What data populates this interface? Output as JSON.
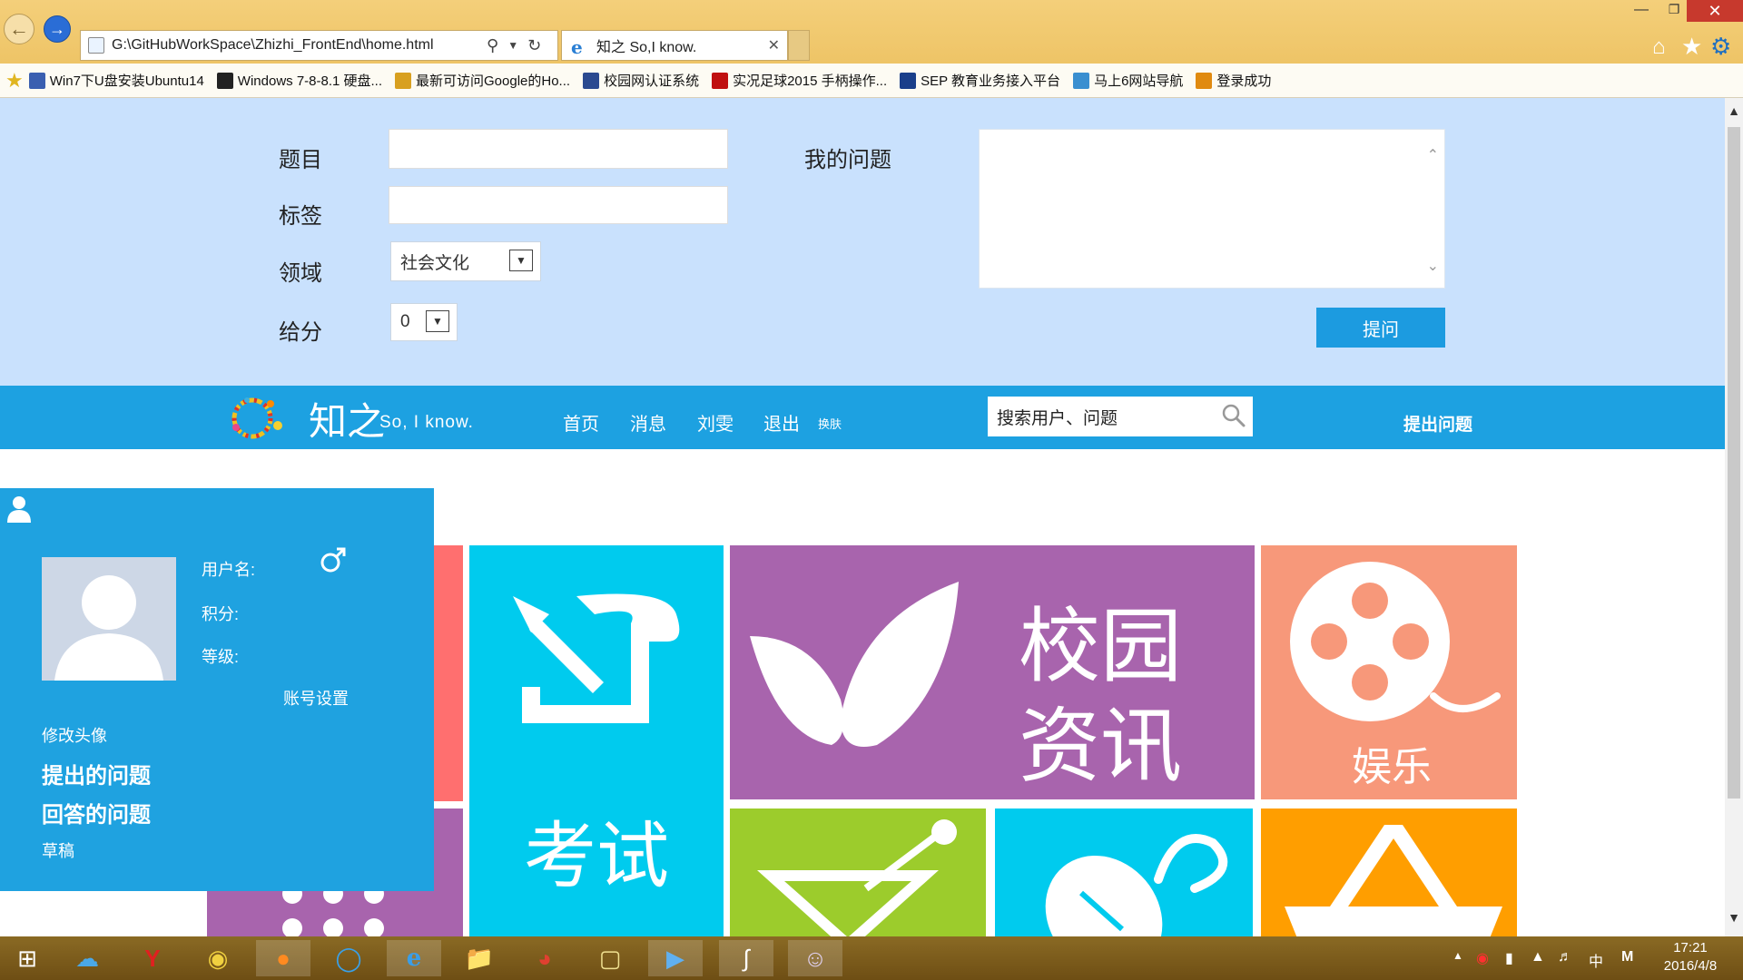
{
  "browser": {
    "address": "G:\\GitHubWorkSpace\\Zhizhi_FrontEnd\\home.html",
    "tab_title": "知之 So,I know.",
    "favorites": [
      {
        "label": "Win7下U盘安装Ubuntu14",
        "color": "#3a5fb0"
      },
      {
        "label": "Windows 7-8-8.1 硬盘...",
        "color": "#222222"
      },
      {
        "label": "最新可访问Google的Ho...",
        "color": "#d8a020"
      },
      {
        "label": "校园网认证系统",
        "color": "#2b4a90"
      },
      {
        "label": "实况足球2015 手柄操作...",
        "color": "#c01010"
      },
      {
        "label": "SEP 教育业务接入平台",
        "color": "#1a3f8a"
      },
      {
        "label": "马上6网站导航",
        "color": "#3a8fd0"
      },
      {
        "label": "登录成功",
        "color": "#e08a10"
      }
    ]
  },
  "ask_form": {
    "title_label": "题目",
    "tags_label": "标签",
    "field_label": "领域",
    "field_value": "社会文化",
    "points_label": "给分",
    "points_value": "0",
    "question_label": "我的问题",
    "submit_label": "提问"
  },
  "nav": {
    "logo_text": "知之",
    "slogan": "So, I know.",
    "links": [
      "首页",
      "消息",
      "刘雯",
      "退出"
    ],
    "skin": "换肤",
    "search_placeholder": "搜索用户、问题",
    "ask_link": "提出问题"
  },
  "tiles": {
    "exam": "考试",
    "campus_line1": "校园",
    "campus_line2": "资讯",
    "entertainment": "娱乐"
  },
  "profile": {
    "username_label": "用户名:",
    "points_label": "积分:",
    "level_label": "等级:",
    "account_settings": "账号设置",
    "change_avatar": "修改头像",
    "asked_questions": "提出的问题",
    "answered_questions": "回答的问题",
    "drafts": "草稿"
  },
  "taskbar": {
    "time": "17:21",
    "date": "2016/4/8",
    "ime": "中",
    "ime2": "M"
  },
  "colors": {
    "nav_blue": "#1da1e1",
    "form_bg": "#c9e1fd",
    "tile_cyan": "#00cbee",
    "tile_purple": "#a864ad",
    "tile_salmon": "#f7987a",
    "tile_red": "#ff6f6f",
    "tile_green": "#9ccc2c",
    "tile_orange": "#ff9e00"
  }
}
